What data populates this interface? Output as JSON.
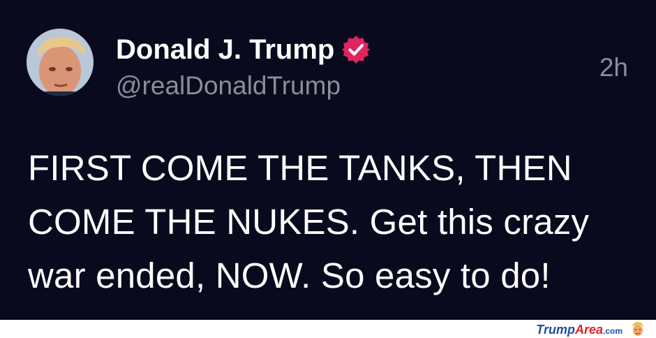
{
  "tweet": {
    "author_name": "Donald J. Trump",
    "handle": "@realDonaldTrump",
    "time": "2h",
    "text": "FIRST COME THE TANKS, THEN COME THE NUKES. Get this crazy war ended, NOW. So easy to do!",
    "badge_icon": "verified-badge-icon",
    "badge_color": "#e0245e",
    "background_color": "#0a0a1e"
  },
  "footer": {
    "brand_part1": "Trump",
    "brand_part2": "Area",
    "brand_suffix": ".com",
    "brand_color": "#1d4fa3",
    "brand_accent": "#d7262c",
    "logo_icon": "trump-face-logo-icon"
  }
}
